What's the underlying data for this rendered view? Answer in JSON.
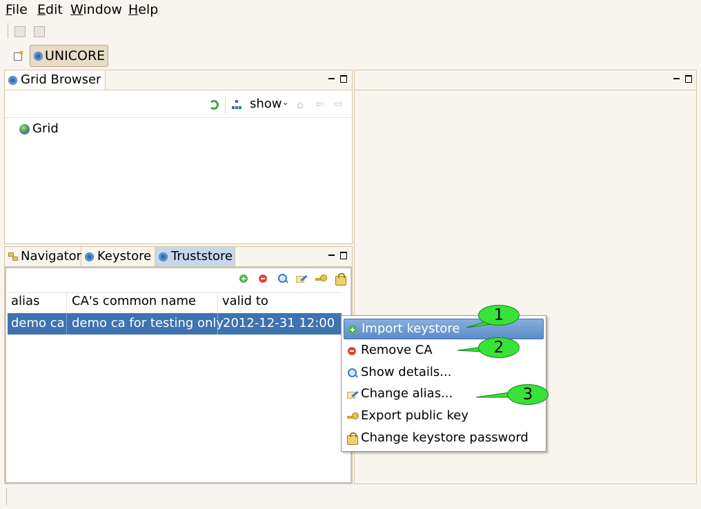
{
  "menubar": {
    "items": [
      "File",
      "Edit",
      "Window",
      "Help"
    ]
  },
  "perspective": {
    "label": "UNICORE"
  },
  "grid_browser": {
    "tab_label": "Grid Browser",
    "show_label": "show",
    "tree_root": "Grid"
  },
  "lower_panel": {
    "tabs": [
      "Navigator",
      "Keystore",
      "Truststore"
    ],
    "active_tab": "Truststore"
  },
  "truststore_table": {
    "columns": [
      "alias",
      "CA's common name",
      "valid to"
    ],
    "rows": [
      {
        "alias": "demo ca",
        "common_name": "demo ca for testing only",
        "valid_to": "2012-12-31 12:00"
      }
    ]
  },
  "context_menu": {
    "items": [
      {
        "label": "Import keystore",
        "icon": "plus-icon",
        "highlighted": true
      },
      {
        "label": "Remove CA",
        "icon": "minus-icon",
        "highlighted": false
      },
      {
        "label": "Show details...",
        "icon": "magnifier-icon",
        "highlighted": false
      },
      {
        "label": "Change alias...",
        "icon": "edit-icon",
        "highlighted": false
      },
      {
        "label": "Export public key",
        "icon": "key-icon",
        "highlighted": false
      },
      {
        "label": "Change keystore password",
        "icon": "keystore-password-icon",
        "highlighted": false
      }
    ]
  },
  "callouts": [
    "1",
    "2",
    "3"
  ],
  "colors": {
    "background": "#f8f5ee",
    "selection": "#3f72b0",
    "menu_highlight": "#6a98d0",
    "callout": "#37e337",
    "panel_border": "#d6c7a8"
  }
}
